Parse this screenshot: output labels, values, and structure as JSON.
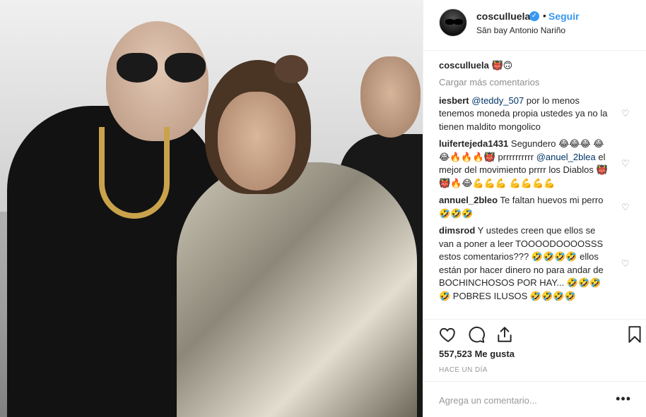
{
  "post": {
    "author": "cosculluela",
    "follow_label": "Seguir",
    "separator": "•",
    "location": "Sân bay Antonio Nariño",
    "caption_emoji": "👹🙃",
    "load_more": "Cargar más comentarios"
  },
  "comments": [
    {
      "user": "iesbert",
      "mention": "@teddy_507",
      "text": " por lo menos tenemos moneda propia ustedes ya no la tienen maldito mongolico"
    },
    {
      "user": "luifertejeda1431",
      "text_a": " Segundero 😂😂😂 😂😂🔥🔥🔥👹 prrrrrrrrrr ",
      "mention": "@anuel_2blea",
      "text_b": " el mejor del movimiento prrrr los Diablos 👹👹🔥😂💪💪💪 💪💪💪💪"
    },
    {
      "user": "annuel_2bleo",
      "text": " Te faltan huevos mi perro 🤣🤣🤣"
    },
    {
      "user": "dimsrod",
      "text": " Y ustedes creen que ellos se van a poner a leer TOOOODOOOOSSS estos comentarios??? 🤣🤣🤣🤣 ellos están por hacer dinero no para andar de BOCHINCHOSOS POR HAY... 🤣🤣🤣🤣 POBRES ILUSOS 🤣🤣🤣🤣"
    }
  ],
  "stats": {
    "likes": "557,523 Me gusta",
    "time": "HACE UN DÍA"
  },
  "composer": {
    "placeholder": "Agrega un comentario...",
    "more": "•••"
  },
  "icons": {
    "verified": "verified-badge-icon",
    "heart": "heart-icon",
    "comment": "comment-bubble-icon",
    "share": "share-icon",
    "save": "bookmark-icon"
  },
  "colors": {
    "link": "#3897f0",
    "mention": "#003569",
    "muted": "#8e8e8e"
  }
}
